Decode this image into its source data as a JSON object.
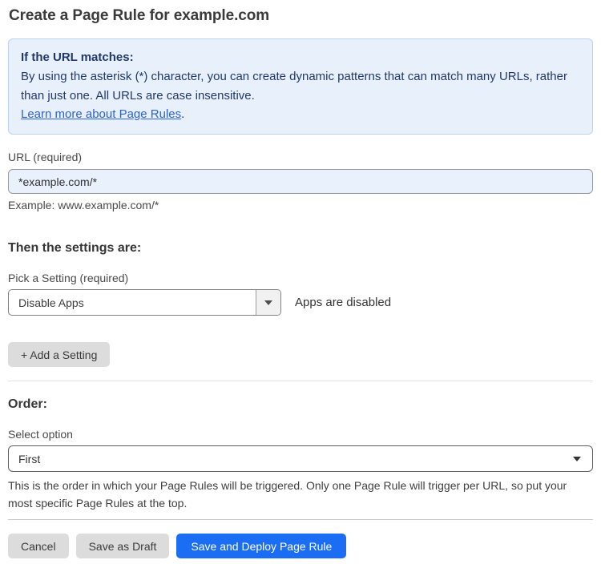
{
  "page": {
    "title": "Create a Page Rule for example.com"
  },
  "info_box": {
    "heading": "If the URL matches:",
    "body": "By using the asterisk (*) character, you can create dynamic patterns that can match many URLs, rather than just one. All URLs are case insensitive.",
    "link_label": "Learn more about Page Rules",
    "link_suffix": "."
  },
  "url_field": {
    "label": "URL (required)",
    "value": "*example.com/*",
    "helper": "Example: www.example.com/*"
  },
  "settings_section": {
    "heading": "Then the settings are:",
    "picker_label": "Pick a Setting (required)",
    "selected_setting": "Disable Apps",
    "setting_status": "Apps are disabled",
    "add_setting_label": "+ Add a Setting"
  },
  "order_section": {
    "heading": "Order:",
    "select_label": "Select option",
    "selected_option": "First",
    "helper": "This is the order in which your Page Rules will be triggered. Only one Page Rule will trigger per URL, so put your most specific Page Rules at the top."
  },
  "footer": {
    "cancel_label": "Cancel",
    "save_draft_label": "Save as Draft",
    "save_deploy_label": "Save and Deploy Page Rule"
  },
  "colors": {
    "info_bg": "#e7f0fb",
    "info_border": "#bcd4f0",
    "info_text": "#21386b",
    "link_blue": "#2d63da",
    "input_bg": "#e9f1fd",
    "primary_button": "#1b6ef3",
    "secondary_button": "#dcdcdc"
  }
}
